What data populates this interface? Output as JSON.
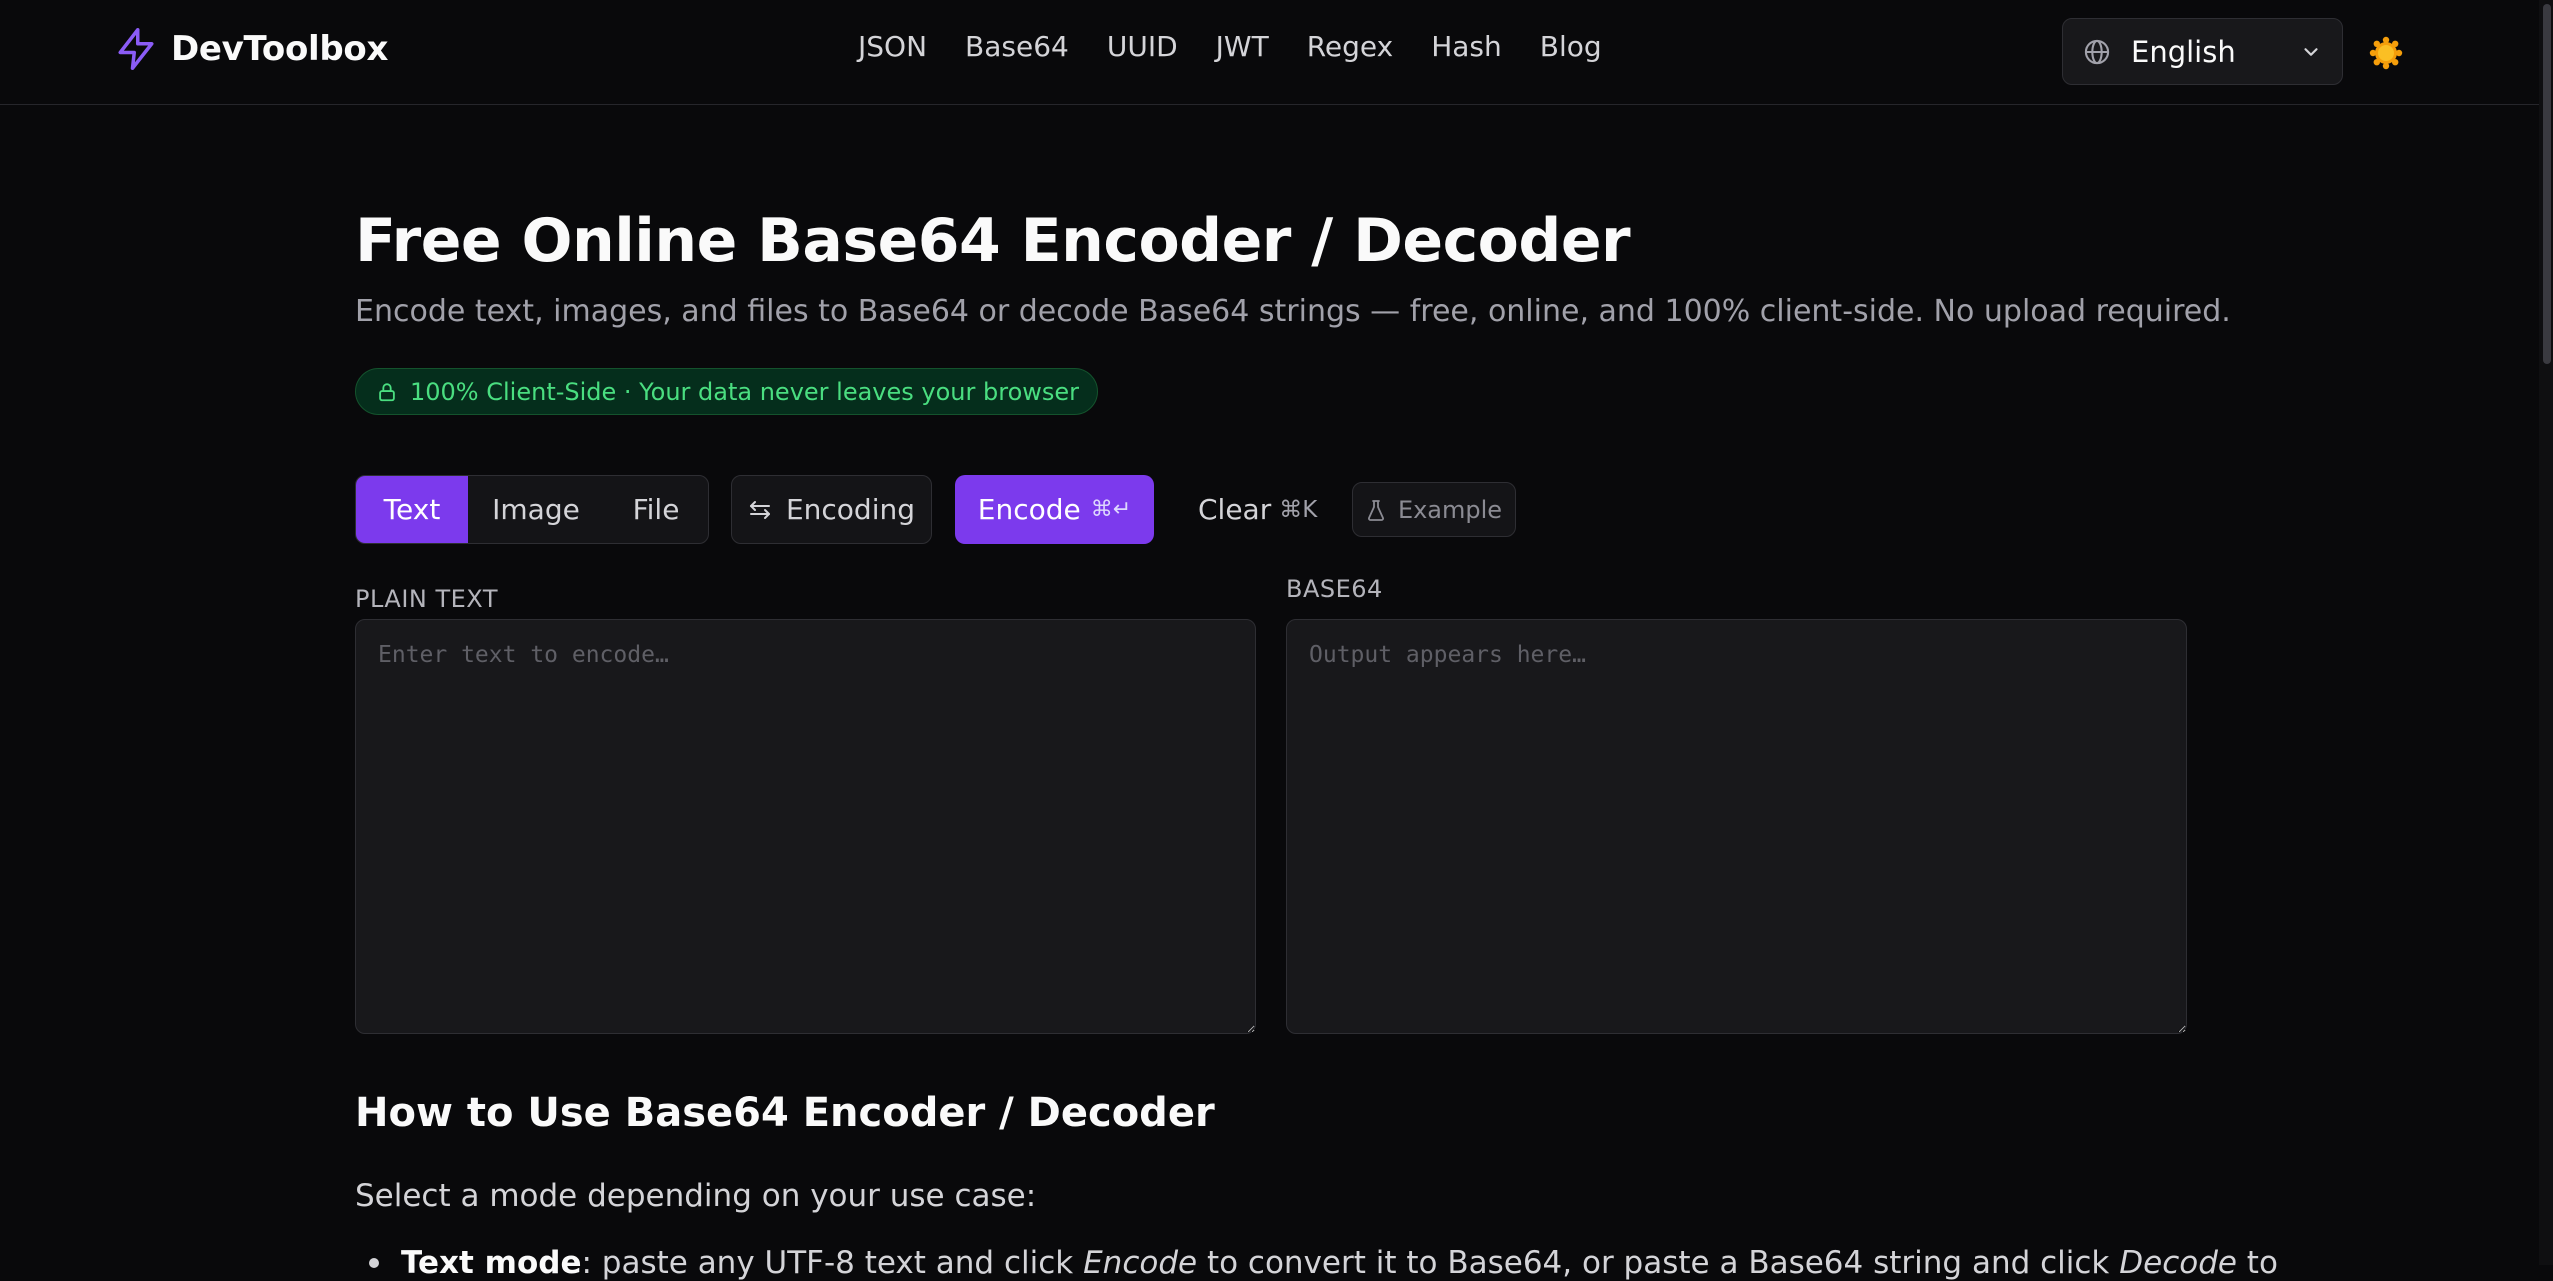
{
  "header": {
    "brand": "DevToolbox",
    "nav": [
      {
        "label": "JSON"
      },
      {
        "label": "Base64"
      },
      {
        "label": "UUID"
      },
      {
        "label": "JWT"
      },
      {
        "label": "Regex"
      },
      {
        "label": "Hash"
      },
      {
        "label": "Blog"
      }
    ],
    "language": {
      "selected": "English",
      "icon": "globe-icon"
    },
    "theme_icon": "sun-icon"
  },
  "main": {
    "title": "Free Online Base64 Encoder / Decoder",
    "subtitle": "Encode text, images, and files to Base64 or decode Base64 strings — free, online, and 100% client-side. No upload required.",
    "privacy_badge": "100% Client-Side · Your data never leaves your browser",
    "toolbar": {
      "modes": [
        {
          "label": "Text",
          "active": true
        },
        {
          "label": "Image",
          "active": false
        },
        {
          "label": "File",
          "active": false
        }
      ],
      "encoding_label": "Encoding",
      "encode_label": "Encode",
      "encode_shortcut": "⌘↵",
      "clear_label": "Clear",
      "clear_shortcut": "⌘K",
      "example_label": "Example"
    },
    "input_panel": {
      "label": "PLAIN TEXT",
      "placeholder": "Enter text to encode…",
      "value": ""
    },
    "output_panel": {
      "label": "BASE64",
      "placeholder": "Output appears here…",
      "value": ""
    },
    "how_to": {
      "heading": "How to Use Base64 Encoder / Decoder",
      "intro": "Select a mode depending on your use case:",
      "items": [
        {
          "term": "Text mode",
          "text_1": ": paste any UTF-8 text and click ",
          "em_1": "Encode",
          "text_2": " to convert it to Base64, or paste a Base64 string and click ",
          "em_2": "Decode",
          "text_3": " to"
        }
      ]
    }
  },
  "colors": {
    "background": "#09090b",
    "accent": "#7c3aed",
    "panel": "#18181b",
    "badge_text": "#4ade80"
  }
}
